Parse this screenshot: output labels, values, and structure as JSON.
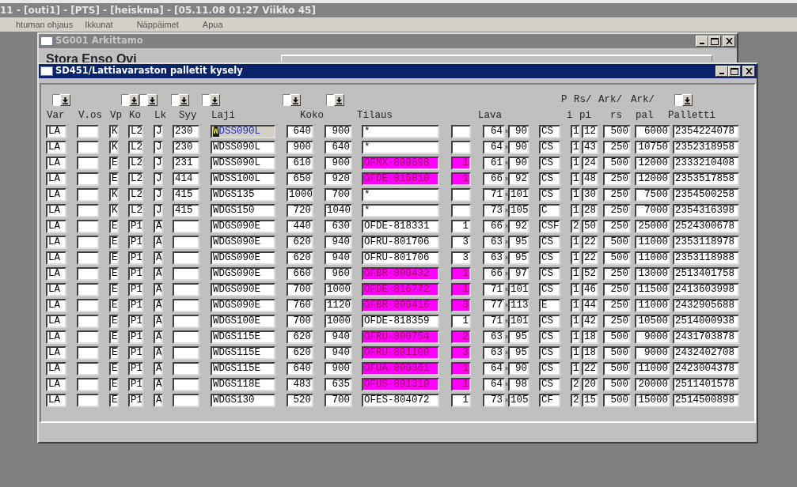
{
  "app_title": "11 - [outi1] - [PTS] - [heiskma] - [05.11.08 01:27 Viikko 45]",
  "menu": [
    "htuman ohjaus",
    "Ikkunat",
    "Näppäimet",
    "Apua"
  ],
  "back_window": {
    "title": "SG001 Arkittamo",
    "active": false,
    "company": "Stora Enso Ovi"
  },
  "front_window": {
    "title": "SD451/Lattiavaraston palletit kysely",
    "active": true,
    "header_top": [
      "P",
      "Rs/",
      "Ark/",
      "Ark/"
    ],
    "headers": [
      "Var",
      "V.os",
      "Vp",
      "Ko",
      "Lk",
      "Syy",
      "Laji",
      "Koko",
      "Tilaus",
      "Lava",
      "i",
      "pi",
      "rs",
      "pal",
      "Palletti"
    ],
    "rows": [
      {
        "var": "LA",
        "vp": "K",
        "ko": "L2",
        "lk": "J",
        "syy": "230",
        "laji": "WDSS090L",
        "koko_1": "640",
        "koko_2": "900",
        "tilaus": "*",
        "lava_1": "64",
        "lava_sep": "x",
        "lava_2": "90",
        "column_14": "CS",
        "p_i": "1",
        "rs_pi": "12",
        "ark_rs": "500",
        "ark_pal": "6000",
        "palletti": "2354224078",
        "highlighted": false,
        "focused": true
      },
      {
        "var": "LA",
        "vp": "K",
        "ko": "L2",
        "lk": "J",
        "syy": "230",
        "laji": "WDSS090L",
        "koko_1": "900",
        "koko_2": "640",
        "tilaus": "*",
        "lava_1": "64",
        "lava_sep": "x",
        "lava_2": "90",
        "column_14": "CS",
        "p_i": "1",
        "rs_pi": "43",
        "ark_rs": "250",
        "ark_pal": "10750",
        "palletti": "2352318958",
        "highlighted": false,
        "focused": false
      },
      {
        "var": "LA",
        "vp": "E",
        "ko": "L2",
        "lk": "J",
        "syy": "231",
        "laji": "WDSS090L",
        "koko_1": "610",
        "koko_2": "900",
        "tilaus": "OFMX-800698",
        "column_11": "1",
        "lava_1": "61",
        "lava_sep": "x",
        "lava_2": "90",
        "column_14": "CS",
        "p_i": "1",
        "rs_pi": "24",
        "ark_rs": "500",
        "ark_pal": "12000",
        "palletti": "2333210408",
        "highlighted": true,
        "focused": false
      },
      {
        "var": "LA",
        "vp": "E",
        "ko": "L2",
        "lk": "J",
        "syy": "414",
        "laji": "WDSS100L",
        "koko_1": "650",
        "koko_2": "920",
        "tilaus": "OFDE-815810",
        "column_11": "1",
        "lava_1": "66",
        "lava_sep": "x",
        "lava_2": "92",
        "column_14": "CS",
        "p_i": "1",
        "rs_pi": "48",
        "ark_rs": "250",
        "ark_pal": "12000",
        "palletti": "2353517858",
        "highlighted": true,
        "focused": false
      },
      {
        "var": "LA",
        "vp": "K",
        "ko": "L2",
        "lk": "J",
        "syy": "415",
        "laji": "WDGS135",
        "koko_1": "1000",
        "koko_2": "700",
        "tilaus": "*",
        "lava_1": "71",
        "lava_sep": "x",
        "lava_2": "101",
        "column_14": "CS",
        "p_i": "1",
        "rs_pi": "30",
        "ark_rs": "250",
        "ark_pal": "7500",
        "palletti": "2354500258",
        "highlighted": false,
        "focused": false
      },
      {
        "var": "LA",
        "vp": "K",
        "ko": "L2",
        "lk": "J",
        "syy": "415",
        "laji": "WDGS150",
        "koko_1": "720",
        "koko_2": "1040",
        "tilaus": "*",
        "lava_1": "73",
        "lava_sep": "x",
        "lava_2": "105",
        "column_14": "C",
        "p_i": "1",
        "rs_pi": "28",
        "ark_rs": "250",
        "ark_pal": "7000",
        "palletti": "2354316398",
        "highlighted": false,
        "focused": false
      },
      {
        "var": "LA",
        "vp": "E",
        "ko": "P1",
        "lk": "A",
        "laji": "WDGS090E",
        "koko_1": "440",
        "koko_2": "630",
        "tilaus": "OFDE-818331",
        "column_11": "1",
        "lava_1": "66",
        "lava_sep": "x",
        "lava_2": "92",
        "column_14": "CSF",
        "p_i": "2",
        "rs_pi": "50",
        "ark_rs": "250",
        "ark_pal": "25000",
        "palletti": "2524300678",
        "highlighted": false,
        "focused": false
      },
      {
        "var": "LA",
        "vp": "E",
        "ko": "P1",
        "lk": "A",
        "laji": "WDGS090E",
        "koko_1": "620",
        "koko_2": "940",
        "tilaus": "OFRU-801706",
        "column_11": "3",
        "lava_1": "63",
        "lava_sep": "x",
        "lava_2": "95",
        "column_14": "CS",
        "p_i": "1",
        "rs_pi": "22",
        "ark_rs": "500",
        "ark_pal": "11000",
        "palletti": "2353118978",
        "highlighted": false,
        "focused": false
      },
      {
        "var": "LA",
        "vp": "E",
        "ko": "P1",
        "lk": "A",
        "laji": "WDGS090E",
        "koko_1": "620",
        "koko_2": "940",
        "tilaus": "OFRU-801706",
        "column_11": "3",
        "lava_1": "63",
        "lava_sep": "x",
        "lava_2": "95",
        "column_14": "CS",
        "p_i": "1",
        "rs_pi": "22",
        "ark_rs": "500",
        "ark_pal": "11000",
        "palletti": "2353118988",
        "highlighted": false,
        "focused": false
      },
      {
        "var": "LA",
        "vp": "E",
        "ko": "P1",
        "lk": "A",
        "laji": "WDGS090E",
        "koko_1": "660",
        "koko_2": "960",
        "tilaus": "OFBR-800432",
        "column_11": "1",
        "lava_1": "66",
        "lava_sep": "x",
        "lava_2": "97",
        "column_14": "CS",
        "p_i": "1",
        "rs_pi": "52",
        "ark_rs": "250",
        "ark_pal": "13000",
        "palletti": "2513401758",
        "highlighted": true,
        "focused": false
      },
      {
        "var": "LA",
        "vp": "E",
        "ko": "P1",
        "lk": "A",
        "laji": "WDGS090E",
        "koko_1": "700",
        "koko_2": "1000",
        "tilaus": "OFDE-816772",
        "column_11": "1",
        "lava_1": "71",
        "lava_sep": "x",
        "lava_2": "101",
        "column_14": "CS",
        "p_i": "1",
        "rs_pi": "46",
        "ark_rs": "250",
        "ark_pal": "11500",
        "palletti": "2413603998",
        "highlighted": true,
        "focused": false
      },
      {
        "var": "LA",
        "vp": "E",
        "ko": "P1",
        "lk": "A",
        "laji": "WDGS090E",
        "koko_1": "760",
        "koko_2": "1120",
        "tilaus": "OFBR-800416",
        "column_11": "3",
        "lava_1": "77",
        "lava_sep": "x",
        "lava_2": "113",
        "column_14": "E",
        "p_i": "1",
        "rs_pi": "44",
        "ark_rs": "250",
        "ark_pal": "11000",
        "palletti": "2432905688",
        "highlighted": true,
        "focused": false
      },
      {
        "var": "LA",
        "vp": "E",
        "ko": "P1",
        "lk": "A",
        "laji": "WDGS100E",
        "koko_1": "700",
        "koko_2": "1000",
        "tilaus": "OFDE-818359",
        "column_11": "1",
        "lava_1": "71",
        "lava_sep": "x",
        "lava_2": "101",
        "column_14": "CS",
        "p_i": "1",
        "rs_pi": "42",
        "ark_rs": "250",
        "ark_pal": "10500",
        "palletti": "2514000938",
        "highlighted": false,
        "focused": false
      },
      {
        "var": "LA",
        "vp": "E",
        "ko": "P1",
        "lk": "A",
        "laji": "WDGS115E",
        "koko_1": "620",
        "koko_2": "940",
        "tilaus": "OFRU-800754",
        "column_11": "2",
        "lava_1": "63",
        "lava_sep": "x",
        "lava_2": "95",
        "column_14": "CS",
        "p_i": "1",
        "rs_pi": "18",
        "ark_rs": "500",
        "ark_pal": "9000",
        "palletti": "2431703878",
        "highlighted": true,
        "focused": false
      },
      {
        "var": "LA",
        "vp": "E",
        "ko": "P1",
        "lk": "A",
        "laji": "WDGS115E",
        "koko_1": "620",
        "koko_2": "940",
        "tilaus": "OFRU-801100",
        "column_11": "3",
        "lava_1": "63",
        "lava_sep": "x",
        "lava_2": "95",
        "column_14": "CS",
        "p_i": "1",
        "rs_pi": "18",
        "ark_rs": "500",
        "ark_pal": "9000",
        "palletti": "2432402708",
        "highlighted": true,
        "focused": false
      },
      {
        "var": "LA",
        "vp": "E",
        "ko": "P1",
        "lk": "A",
        "laji": "WDGS115E",
        "koko_1": "640",
        "koko_2": "900",
        "tilaus": "OFUA-800361",
        "column_11": "1",
        "lava_1": "64",
        "lava_sep": "x",
        "lava_2": "90",
        "column_14": "CS",
        "p_i": "1",
        "rs_pi": "22",
        "ark_rs": "500",
        "ark_pal": "11000",
        "palletti": "2423004378",
        "highlighted": true,
        "focused": false
      },
      {
        "var": "LA",
        "vp": "E",
        "ko": "P1",
        "lk": "A",
        "laji": "WDGS118E",
        "koko_1": "483",
        "koko_2": "635",
        "tilaus": "OFUS-801310",
        "column_11": "1",
        "lava_1": "64",
        "lava_sep": "x",
        "lava_2": "98",
        "column_14": "CS",
        "p_i": "2",
        "rs_pi": "20",
        "ark_rs": "500",
        "ark_pal": "20000",
        "palletti": "2511401578",
        "highlighted": true,
        "focused": false
      },
      {
        "var": "LA",
        "vp": "E",
        "ko": "P1",
        "lk": "A",
        "laji": "WDGS130",
        "koko_1": "520",
        "koko_2": "700",
        "tilaus": "OFES-804072",
        "column_11": "1",
        "lava_1": "73",
        "lava_sep": "x",
        "lava_2": "105",
        "column_14": "CF",
        "p_i": "2",
        "rs_pi": "15",
        "ark_rs": "500",
        "ark_pal": "15000",
        "palletti": "2514500898",
        "highlighted": false,
        "focused": false
      }
    ]
  }
}
